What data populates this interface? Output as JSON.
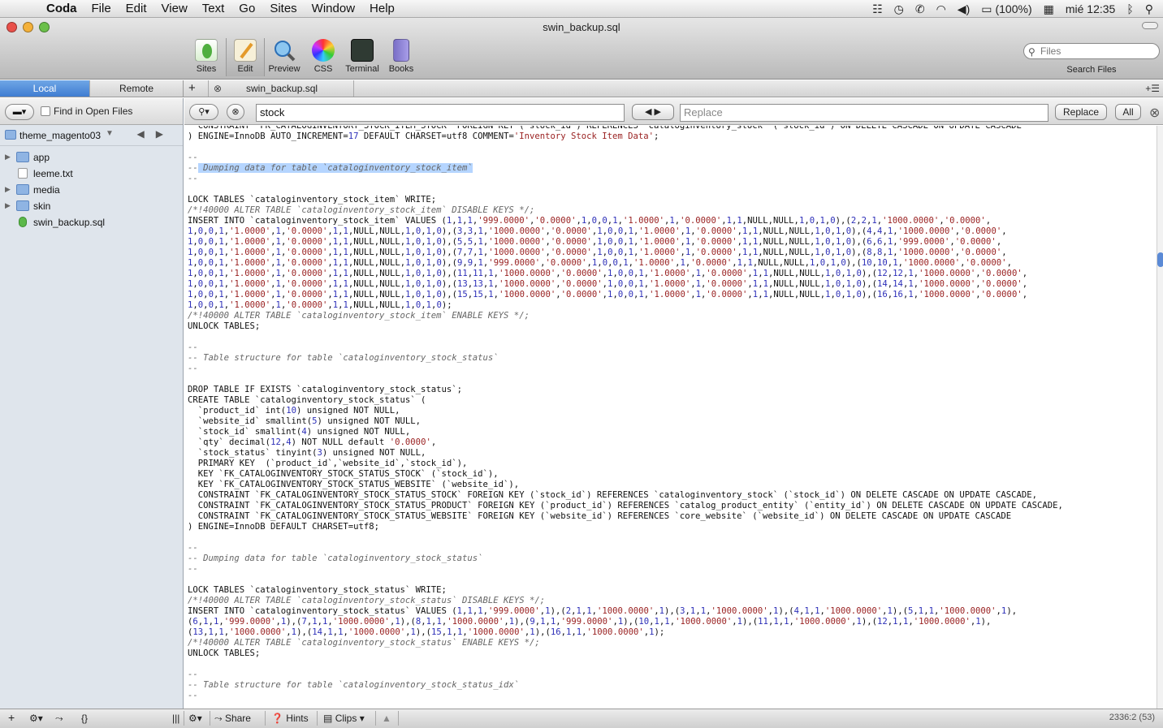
{
  "menubar": {
    "app_name": "Coda",
    "items": [
      "File",
      "Edit",
      "View",
      "Text",
      "Go",
      "Sites",
      "Window",
      "Help"
    ],
    "battery": "(100%)",
    "clock": "mié 12:35"
  },
  "window": {
    "title": "swin_backup.sql"
  },
  "toolbar": {
    "buttons": [
      "Sites",
      "Edit",
      "Preview",
      "CSS",
      "Terminal",
      "Books"
    ],
    "selected": "Edit"
  },
  "search": {
    "placeholder": "Files",
    "label": "Search Files"
  },
  "tabs": {
    "local": "Local",
    "remote": "Remote",
    "add": "+",
    "doc_tab": "swin_backup.sql"
  },
  "sidebar": {
    "find_in_open_files": "Find in Open Files",
    "current_folder": "theme_magento03",
    "items": [
      {
        "label": "app",
        "type": "folder"
      },
      {
        "label": "leeme.txt",
        "type": "file"
      },
      {
        "label": "media",
        "type": "folder"
      },
      {
        "label": "skin",
        "type": "folder"
      },
      {
        "label": "swin_backup.sql",
        "type": "sql"
      }
    ]
  },
  "find": {
    "query": "stock",
    "replace_placeholder": "Replace",
    "replace_btn": "Replace",
    "all_btn": "All"
  },
  "status": {
    "share": "Share",
    "hints": "Hints",
    "clips": "Clips",
    "cursor": "2336:2 (53)"
  },
  "code_lines": [
    "  CONSTRAINT `FK_CATALOGINVENTORY_STOCK_ITEM_STOCK` FOREIGN KEY (`stock_id`) REFERENCES `cataloginventory_stock` (`stock_id`) ON DELETE CASCADE ON UPDATE CASCADE",
    ") ENGINE=InnoDB AUTO_INCREMENT=17 DEFAULT CHARSET=utf8 COMMENT='Inventory Stock Item Data';",
    "",
    "--",
    "-- Dumping data for table `cataloginventory_stock_item`",
    "--",
    "",
    "LOCK TABLES `cataloginventory_stock_item` WRITE;",
    "/*!40000 ALTER TABLE `cataloginventory_stock_item` DISABLE KEYS */;",
    "INSERT INTO `cataloginventory_stock_item` VALUES (1,1,1,'999.0000','0.0000',1,0,0,1,'1.0000',1,'0.0000',1,1,NULL,NULL,1,0,1,0),(2,2,1,'1000.0000','0.0000',",
    "1,0,0,1,'1.0000',1,'0.0000',1,1,NULL,NULL,1,0,1,0),(3,3,1,'1000.0000','0.0000',1,0,0,1,'1.0000',1,'0.0000',1,1,NULL,NULL,1,0,1,0),(4,4,1,'1000.0000','0.0000',",
    "1,0,0,1,'1.0000',1,'0.0000',1,1,NULL,NULL,1,0,1,0),(5,5,1,'1000.0000','0.0000',1,0,0,1,'1.0000',1,'0.0000',1,1,NULL,NULL,1,0,1,0),(6,6,1,'999.0000','0.0000',",
    "1,0,0,1,'1.0000',1,'0.0000',1,1,NULL,NULL,1,0,1,0),(7,7,1,'1000.0000','0.0000',1,0,0,1,'1.0000',1,'0.0000',1,1,NULL,NULL,1,0,1,0),(8,8,1,'1000.0000','0.0000',",
    "1,0,0,1,'1.0000',1,'0.0000',1,1,NULL,NULL,1,0,1,0),(9,9,1,'999.0000','0.0000',1,0,0,1,'1.0000',1,'0.0000',1,1,NULL,NULL,1,0,1,0),(10,10,1,'1000.0000','0.0000',",
    "1,0,0,1,'1.0000',1,'0.0000',1,1,NULL,NULL,1,0,1,0),(11,11,1,'1000.0000','0.0000',1,0,0,1,'1.0000',1,'0.0000',1,1,NULL,NULL,1,0,1,0),(12,12,1,'1000.0000','0.0000',",
    "1,0,0,1,'1.0000',1,'0.0000',1,1,NULL,NULL,1,0,1,0),(13,13,1,'1000.0000','0.0000',1,0,0,1,'1.0000',1,'0.0000',1,1,NULL,NULL,1,0,1,0),(14,14,1,'1000.0000','0.0000',",
    "1,0,0,1,'1.0000',1,'0.0000',1,1,NULL,NULL,1,0,1,0),(15,15,1,'1000.0000','0.0000',1,0,0,1,'1.0000',1,'0.0000',1,1,NULL,NULL,1,0,1,0),(16,16,1,'1000.0000','0.0000',",
    "1,0,0,1,'1.0000',1,'0.0000',1,1,NULL,NULL,1,0,1,0);",
    "/*!40000 ALTER TABLE `cataloginventory_stock_item` ENABLE KEYS */;",
    "UNLOCK TABLES;",
    "",
    "--",
    "-- Table structure for table `cataloginventory_stock_status`",
    "--",
    "",
    "DROP TABLE IF EXISTS `cataloginventory_stock_status`;",
    "CREATE TABLE `cataloginventory_stock_status` (",
    "  `product_id` int(10) unsigned NOT NULL,",
    "  `website_id` smallint(5) unsigned NOT NULL,",
    "  `stock_id` smallint(4) unsigned NOT NULL,",
    "  `qty` decimal(12,4) NOT NULL default '0.0000',",
    "  `stock_status` tinyint(3) unsigned NOT NULL,",
    "  PRIMARY KEY  (`product_id`,`website_id`,`stock_id`),",
    "  KEY `FK_CATALOGINVENTORY_STOCK_STATUS_STOCK` (`stock_id`),",
    "  KEY `FK_CATALOGINVENTORY_STOCK_STATUS_WEBSITE` (`website_id`),",
    "  CONSTRAINT `FK_CATALOGINVENTORY_STOCK_STATUS_STOCK` FOREIGN KEY (`stock_id`) REFERENCES `cataloginventory_stock` (`stock_id`) ON DELETE CASCADE ON UPDATE CASCADE,",
    "  CONSTRAINT `FK_CATALOGINVENTORY_STOCK_STATUS_PRODUCT` FOREIGN KEY (`product_id`) REFERENCES `catalog_product_entity` (`entity_id`) ON DELETE CASCADE ON UPDATE CASCADE,",
    "  CONSTRAINT `FK_CATALOGINVENTORY_STOCK_STATUS_WEBSITE` FOREIGN KEY (`website_id`) REFERENCES `core_website` (`website_id`) ON DELETE CASCADE ON UPDATE CASCADE",
    ") ENGINE=InnoDB DEFAULT CHARSET=utf8;",
    "",
    "--",
    "-- Dumping data for table `cataloginventory_stock_status`",
    "--",
    "",
    "LOCK TABLES `cataloginventory_stock_status` WRITE;",
    "/*!40000 ALTER TABLE `cataloginventory_stock_status` DISABLE KEYS */;",
    "INSERT INTO `cataloginventory_stock_status` VALUES (1,1,1,'999.0000',1),(2,1,1,'1000.0000',1),(3,1,1,'1000.0000',1),(4,1,1,'1000.0000',1),(5,1,1,'1000.0000',1),",
    "(6,1,1,'999.0000',1),(7,1,1,'1000.0000',1),(8,1,1,'1000.0000',1),(9,1,1,'999.0000',1),(10,1,1,'1000.0000',1),(11,1,1,'1000.0000',1),(12,1,1,'1000.0000',1),",
    "(13,1,1,'1000.0000',1),(14,1,1,'1000.0000',1),(15,1,1,'1000.0000',1),(16,1,1,'1000.0000',1);",
    "/*!40000 ALTER TABLE `cataloginventory_stock_status` ENABLE KEYS */;",
    "UNLOCK TABLES;",
    "",
    "--",
    "-- Table structure for table `cataloginventory_stock_status_idx`",
    "--"
  ],
  "highlight_line": 4,
  "colors": {
    "accent": "#3f7dd1",
    "comment": "#666666",
    "number": "#2d2fb8",
    "keyword": "#9a2222"
  }
}
